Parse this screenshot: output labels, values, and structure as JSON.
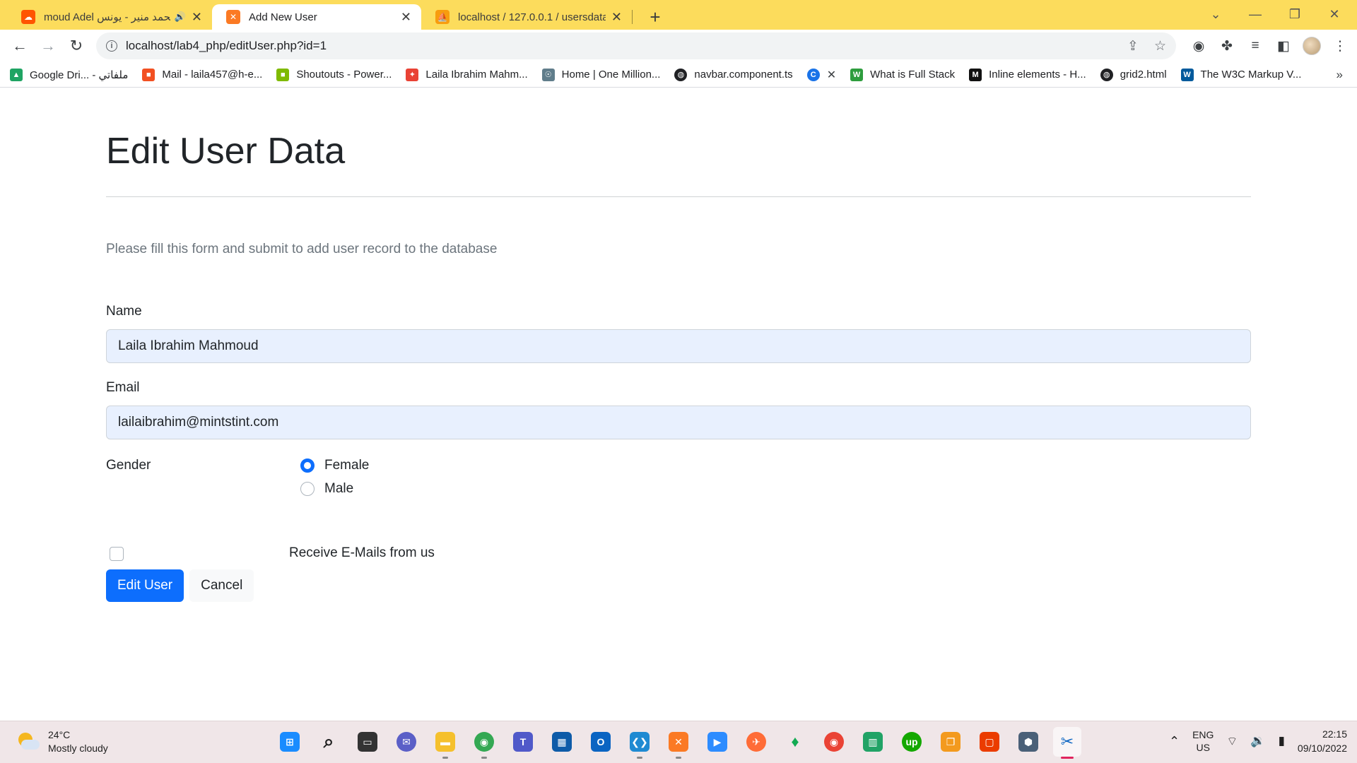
{
  "browser": {
    "tabs": [
      {
        "title": "moud Adel محمد منير - يونس",
        "favicon": "soundcloud-icon",
        "color": "#ff5500",
        "active": false
      },
      {
        "title": "Add New User",
        "favicon": "xampp-icon",
        "color": "#fb7a24",
        "active": true
      },
      {
        "title": "localhost / 127.0.0.1 / usersdata",
        "favicon": "phpmyadmin-icon",
        "color": "#f89c0e",
        "active": false
      }
    ],
    "url": "localhost/lab4_php/editUser.php?id=1",
    "bookmarks": [
      {
        "label": "Google Dri... - ملفاتي",
        "icon": "google-drive-icon",
        "color": "#1fa463"
      },
      {
        "label": "Mail - laila457@h-e...",
        "icon": "microsoft-icon",
        "color": "#f25022"
      },
      {
        "label": "Shoutouts - Power...",
        "icon": "microsoft-icon",
        "color": "#7fba00"
      },
      {
        "label": "Laila Ibrahim Mahm...",
        "icon": "pinwheel-icon",
        "color": "#e94235"
      },
      {
        "label": "Home | One Million...",
        "icon": "badge-icon",
        "color": "#607d8b"
      },
      {
        "label": "navbar.component.ts",
        "icon": "globe-icon",
        "color": "#202124"
      },
      {
        "label": "",
        "icon": "c-icon",
        "color": "#1a73e8"
      },
      {
        "label": "What is Full Stack",
        "icon": "w-icon",
        "color": "#2e9d3e"
      },
      {
        "label": "Inline elements - H...",
        "icon": "m-icon",
        "color": "#111111"
      },
      {
        "label": "grid2.html",
        "icon": "globe-icon",
        "color": "#202124"
      },
      {
        "label": "The W3C Markup V...",
        "icon": "w3c-icon",
        "color": "#005a9c"
      }
    ]
  },
  "form": {
    "heading": "Edit User Data",
    "lead": "Please fill this form and submit to add user record to the database",
    "name_label": "Name",
    "name_value": "Laila Ibrahim Mahmoud",
    "email_label": "Email",
    "email_value": "lailaibrahim@mintstint.com",
    "gender_label": "Gender",
    "gender_options": [
      "Female",
      "Male"
    ],
    "gender_selected": "Female",
    "newsletter_label": "Receive E-Mails from us",
    "newsletter_checked": false,
    "submit_label": "Edit User",
    "cancel_label": "Cancel"
  },
  "taskbar": {
    "temperature": "24°C",
    "weather": "Mostly cloudy",
    "lang_top": "ENG",
    "lang_bottom": "US",
    "time": "22:15",
    "date": "09/10/2022"
  },
  "colors": {
    "tabbar": "#fcdc5c",
    "primary": "#0d6efd",
    "autofill": "#e8f0fe"
  }
}
